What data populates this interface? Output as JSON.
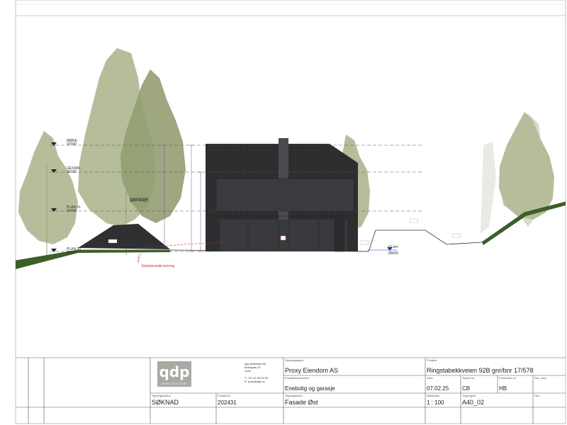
{
  "drawing": {
    "levels": [
      {
        "name": "MØNE",
        "value": "97090"
      },
      {
        "name": "GESIMS",
        "value": "95150"
      },
      {
        "name": "PLAN 01",
        "value": "92400"
      },
      {
        "name": "PLAN 00",
        "value": "89600"
      }
    ],
    "annotations": {
      "garage_label": "garasje",
      "terrain_label": "Eksisterende terreng",
      "ground_label": "Gj terr",
      "ground_value": "89600"
    }
  },
  "office": {
    "logo_text": "qdp",
    "logo_sub": "ARKITEKTER",
    "name": "qdp arkitekter AS",
    "street": "Kirkegata 10",
    "postal": "1440",
    "phone": "T: +47 92 05 02 80",
    "email": "E: post@qdp.no"
  },
  "title_block": {
    "status_caption": "Tegningsstatus",
    "status_value": "SØKNAD",
    "project_no_caption": "Prosjektnr.",
    "project_no_value": "202431",
    "client_caption": "Oppdragsgiver",
    "client_value": "Proxy Eiendom AS",
    "description_caption": "Prosjektbeskrivelse",
    "description_value": "Enebolig og garasje",
    "drawing_name_caption": "Tegningsnavn",
    "drawing_name_value": "Fasade Øst",
    "project_caption": "Prosjekt",
    "project_value": "Ringstabekkveien 92B gnr/bnr 17/578",
    "date_caption": "Dato:",
    "date_value": "07.02.25",
    "drawn_caption": "Tegnet av:",
    "drawn_value": "CB",
    "checked_caption": "Kontrollert av:",
    "checked_value": "HB",
    "rev_date_caption": "Rev. dato",
    "scale_caption": "Målestokk",
    "scale_value": "1 : 100",
    "sheet_caption": "Tegningsnr",
    "sheet_value": "A40_02",
    "rev_caption": "Rev.:"
  },
  "colors": {
    "tree": "#b5bd9b",
    "tree_dark": "#949d72",
    "building": "#2d2e30",
    "terrain_red": "#d8262a",
    "grass": "#3d5f2a"
  }
}
